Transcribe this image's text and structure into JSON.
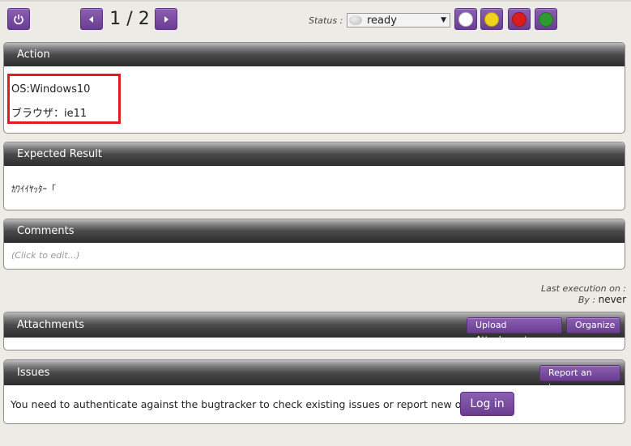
{
  "pager": {
    "text": "1 / 2"
  },
  "status": {
    "label": "Status :",
    "value": "ready"
  },
  "status_buttons": [
    {
      "name": "untested",
      "color": "#ffffff"
    },
    {
      "name": "blocked",
      "color": "#f1d21c"
    },
    {
      "name": "failed",
      "color": "#d91c1c"
    },
    {
      "name": "passed",
      "color": "#2f9a2f"
    }
  ],
  "action": {
    "title": "Action",
    "lines": [
      "OS:Windows10",
      "ブラウザ：ie11"
    ]
  },
  "expected": {
    "title": "Expected Result",
    "text": "ｶﾜｲｲﾔｯﾀｰ「"
  },
  "comments": {
    "title": "Comments",
    "placeholder": "(Click to edit...)"
  },
  "execution": {
    "last_label": "Last execution on :",
    "by_label": "By :",
    "by_value": "never"
  },
  "attachments": {
    "title": "Attachments",
    "upload_label": "Upload Attachment",
    "organize_label": "Organize"
  },
  "issues": {
    "title": "Issues",
    "report_label": "Report an issue",
    "message": "You need to authenticate against the bugtracker to check existing issues or report new ones.",
    "login_label": "Log in"
  }
}
